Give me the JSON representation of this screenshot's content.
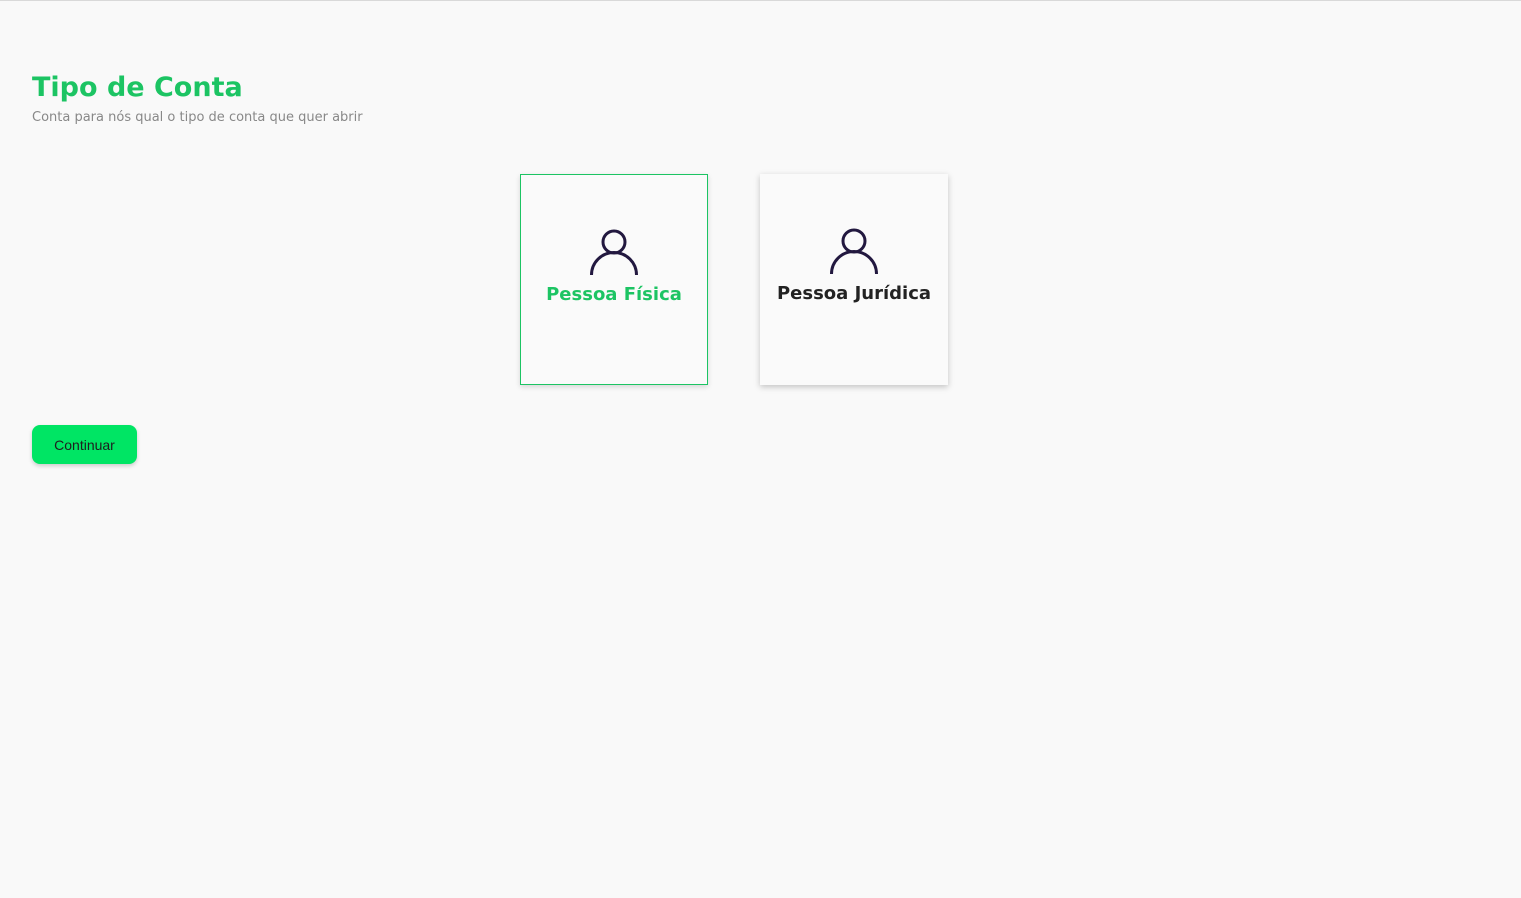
{
  "header": {
    "title": "Tipo de Conta",
    "subtitle": "Conta para nós qual o tipo de conta que quer abrir"
  },
  "account_types": [
    {
      "label": "Pessoa Física",
      "icon": "user-icon",
      "selected": true
    },
    {
      "label": "Pessoa Jurídica",
      "icon": "user-icon",
      "selected": false
    }
  ],
  "actions": {
    "continue_label": "Continuar"
  },
  "colors": {
    "accent": "#1cc463",
    "button": "#00e564",
    "icon": "#22183f",
    "background": "#f9f9f9"
  }
}
